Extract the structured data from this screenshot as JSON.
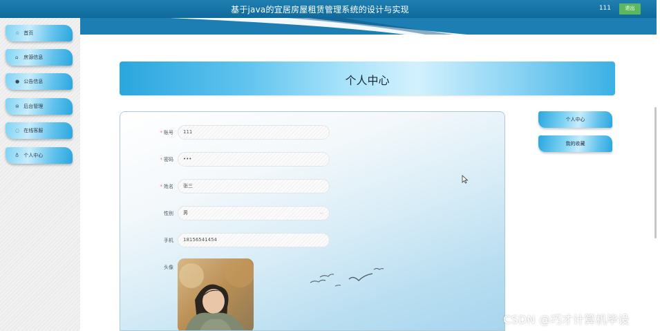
{
  "header": {
    "title": "基于java的宜居房屋租赁管理系统的设计与实现",
    "username": "111",
    "logout_label": "退出"
  },
  "sidebar": {
    "items": [
      {
        "label": "首页",
        "icon": "star-icon"
      },
      {
        "label": "房源信息",
        "icon": "house-icon"
      },
      {
        "label": "公告信息",
        "icon": "notice-icon"
      },
      {
        "label": "后台管理",
        "icon": "admin-icon"
      },
      {
        "label": "在线客服",
        "icon": "service-icon"
      },
      {
        "label": "个人中心",
        "icon": "user-icon"
      }
    ]
  },
  "page": {
    "title": "个人中心"
  },
  "form": {
    "account": {
      "label": "账号",
      "value": "111",
      "required": true
    },
    "password": {
      "label": "密码",
      "value": "•••",
      "required": true
    },
    "name": {
      "label": "姓名",
      "value": "张三",
      "required": true
    },
    "gender": {
      "label": "性别",
      "value": "男"
    },
    "phone": {
      "label": "手机",
      "value": "18156541454"
    },
    "avatar": {
      "label": "头像"
    }
  },
  "side_nav": {
    "personal_center": "个人中心",
    "favorites": "我的收藏"
  },
  "watermark": "CSDN @巧才计算机毕设",
  "colors": {
    "header_bg": "#1f7fb0",
    "accent_blue": "#2aa7df",
    "logout_green": "#5cb85c",
    "required_red": "#f56c6c"
  }
}
